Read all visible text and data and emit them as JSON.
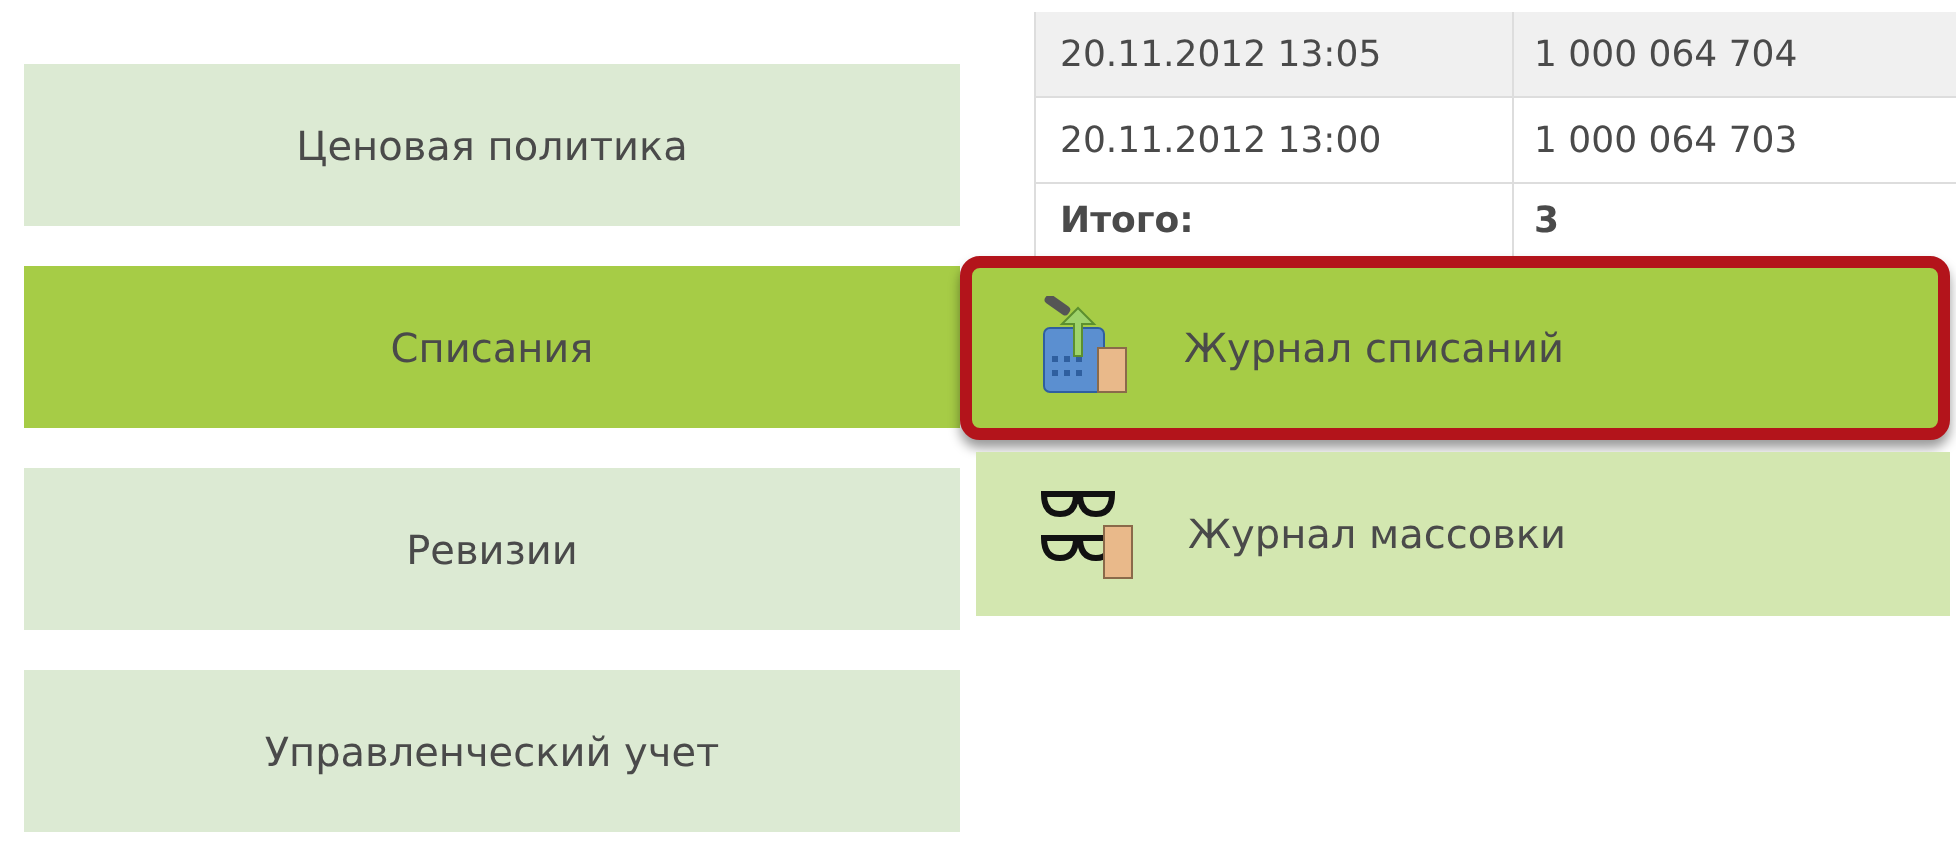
{
  "menu": [
    {
      "label": "Ценовая политика",
      "selected": false
    },
    {
      "label": "Списания",
      "selected": true
    },
    {
      "label": "Ревизии",
      "selected": false
    },
    {
      "label": "Управленческий учет",
      "selected": false
    }
  ],
  "table": {
    "rows": [
      [
        "20.11.2012 13:05",
        "1 000 064 704"
      ],
      [
        "20.11.2012 13:00",
        "1 000 064 703"
      ]
    ],
    "total": {
      "label": "Итого:",
      "value": "3"
    }
  },
  "submenu": [
    {
      "label": "Журнал списаний",
      "kind": "writeoff",
      "selected": true
    },
    {
      "label": "Журнал массовки",
      "kind": "glasses",
      "selected": false
    }
  ]
}
